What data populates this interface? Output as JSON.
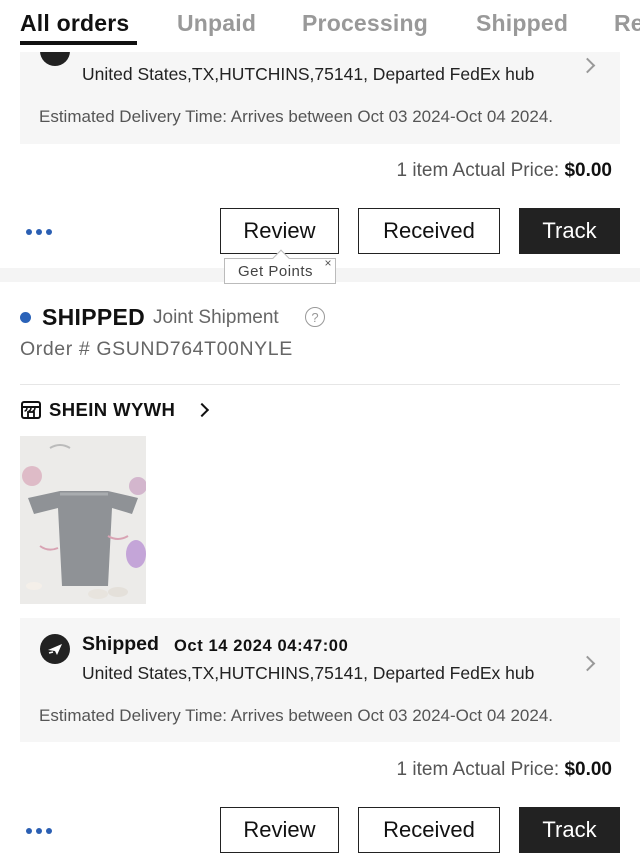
{
  "tabs": {
    "all": "All orders",
    "unpaid": "Unpaid",
    "processing": "Processing",
    "shipped": "Shipped",
    "returns": "Re"
  },
  "order_top": {
    "location": "United States,TX,HUTCHINS,75141, Departed FedEx hub",
    "eta": "Estimated Delivery Time: Arrives between Oct 03 2024-Oct 04 2024.",
    "price_label": "1 item Actual Price:",
    "price_value": "$0.00",
    "more_label": "•••",
    "review_label": "Review",
    "received_label": "Received",
    "track_label": "Track",
    "points_tip": "Get Points",
    "points_close": "×"
  },
  "order_second": {
    "status": "SHIPPED",
    "shipment_type": "Joint Shipment",
    "help_glyph": "?",
    "order_number": "Order # GSUND764T00NYLE",
    "store_name": "SHEIN WYWH",
    "shipping_title": "Shipped",
    "shipping_time": "Oct 14 2024 04:47:00",
    "location": "United States,TX,HUTCHINS,75141, Departed FedEx hub",
    "eta": "Estimated Delivery Time: Arrives between Oct 03 2024-Oct 04 2024.",
    "price_label": "1 item Actual Price:",
    "price_value": "$0.00",
    "more_label": "•••",
    "review_label": "Review",
    "received_label": "Received",
    "track_label": "Track"
  },
  "icons": {
    "status_dot": "status-dot",
    "help": "help-circle-icon",
    "store": "store-icon",
    "shipping": "plane-icon",
    "chevron": "chevron-right-icon",
    "more": "more-dots-icon"
  },
  "colors": {
    "accent_blue": "#2a62b8",
    "dark_button": "#222222",
    "panel_bg": "#f6f6f6"
  }
}
